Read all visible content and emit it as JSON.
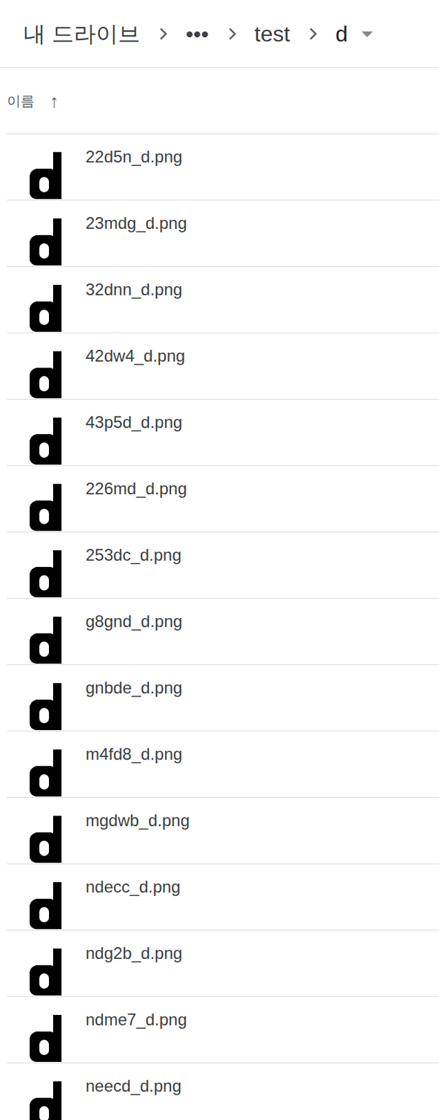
{
  "breadcrumb": {
    "items": [
      "내 드라이브",
      "•••",
      "test",
      "d"
    ]
  },
  "sort_header": {
    "label": "이름",
    "arrow": "↑"
  },
  "files": [
    {
      "name": "22d5n_d.png"
    },
    {
      "name": "23mdg_d.png"
    },
    {
      "name": "32dnn_d.png"
    },
    {
      "name": "42dw4_d.png"
    },
    {
      "name": "43p5d_d.png"
    },
    {
      "name": "226md_d.png"
    },
    {
      "name": "253dc_d.png"
    },
    {
      "name": "g8gnd_d.png"
    },
    {
      "name": "gnbde_d.png"
    },
    {
      "name": "m4fd8_d.png"
    },
    {
      "name": "mgdwb_d.png"
    },
    {
      "name": "ndecc_d.png"
    },
    {
      "name": "ndg2b_d.png"
    },
    {
      "name": "ndme7_d.png"
    },
    {
      "name": "neecd_d.png"
    }
  ]
}
